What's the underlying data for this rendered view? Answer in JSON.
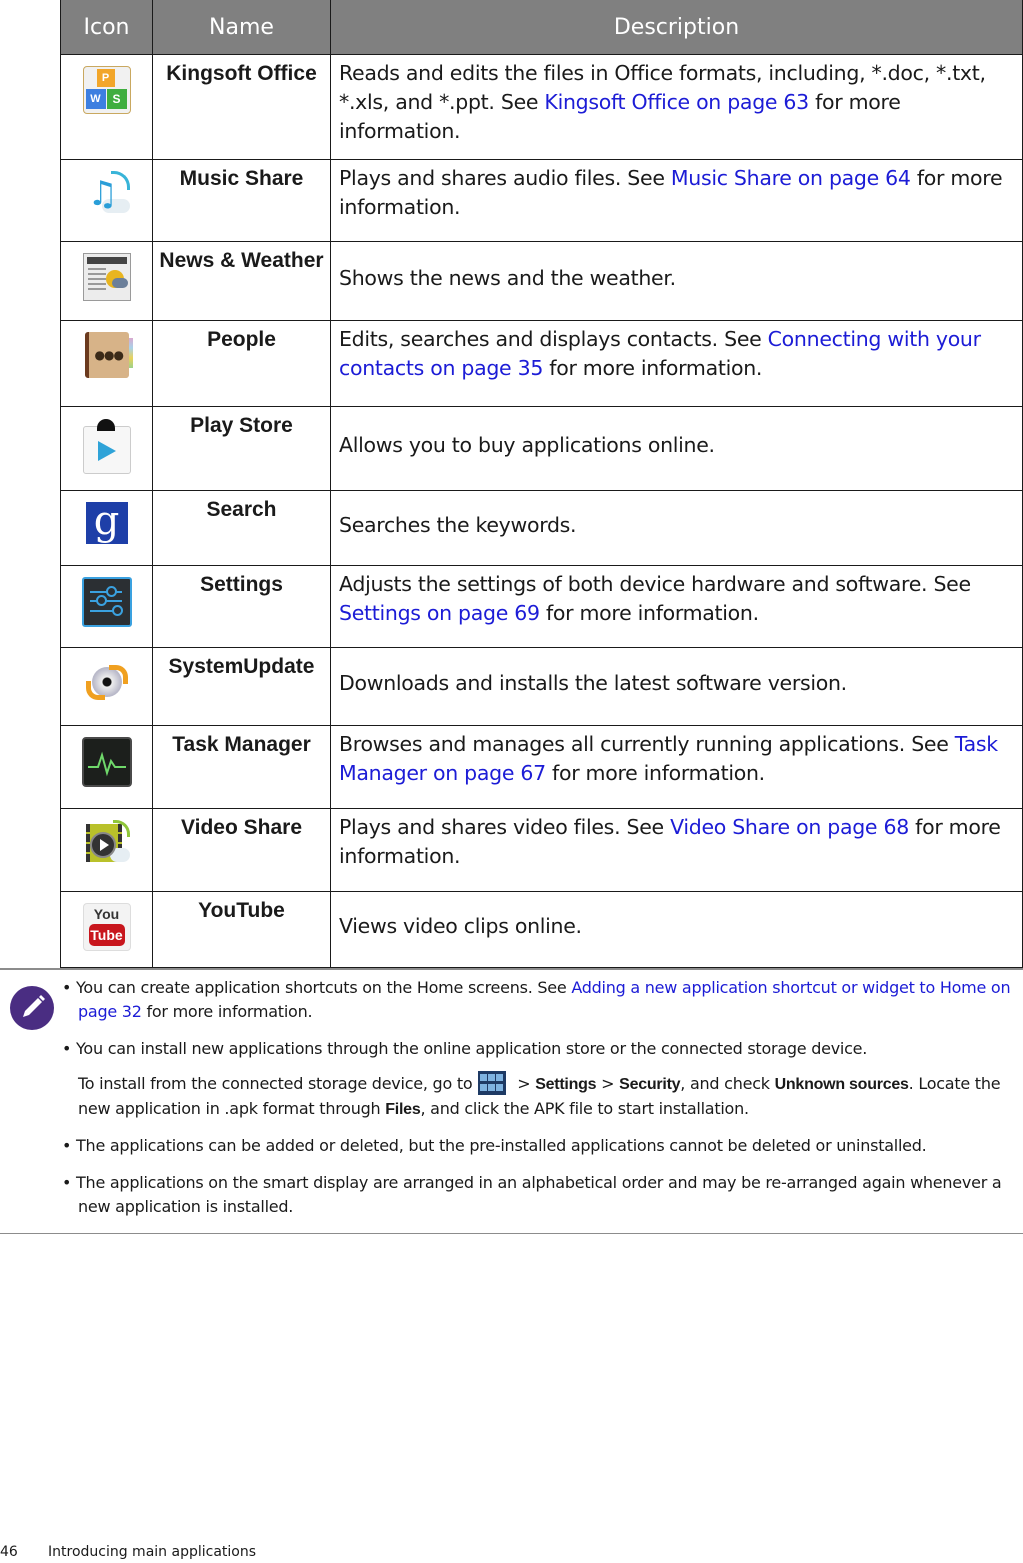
{
  "table": {
    "headers": [
      "Icon",
      "Name",
      "Description"
    ],
    "rows": [
      {
        "icon": "kingsoft-office-icon",
        "name": "Kingsoft Office",
        "desc_before": "Reads and edits the files in Office formats, including, *.doc, *.txt, *.xls, and *.ppt. See ",
        "link": "Kingsoft Office on page 63",
        "desc_after": " for more information."
      },
      {
        "icon": "music-share-icon",
        "name": "Music Share",
        "desc_before": "Plays and shares audio files. See ",
        "link": "Music Share on page 64",
        "desc_after": " for more information."
      },
      {
        "icon": "news-weather-icon",
        "name": "News & Weather",
        "desc_before": "Shows the news and the weather.",
        "link": "",
        "desc_after": ""
      },
      {
        "icon": "people-icon",
        "name": "People",
        "desc_before": "Edits, searches and displays contacts. See ",
        "link": "Connecting with your contacts on page 35",
        "desc_after": " for more information."
      },
      {
        "icon": "play-store-icon",
        "name": "Play Store",
        "desc_before": "Allows you to buy applications online.",
        "link": "",
        "desc_after": ""
      },
      {
        "icon": "search-icon",
        "name": "Search",
        "desc_before": "Searches the keywords.",
        "link": "",
        "desc_after": ""
      },
      {
        "icon": "settings-icon",
        "name": "Settings",
        "desc_before": "Adjusts the settings of both device hardware and software. See ",
        "link": "Settings on page 69",
        "desc_after": " for more information."
      },
      {
        "icon": "system-update-icon",
        "name": "SystemUpdate",
        "desc_before": "Downloads and installs the latest software version.",
        "link": "",
        "desc_after": ""
      },
      {
        "icon": "task-manager-icon",
        "name": "Task Manager",
        "desc_before": "Browses and manages all currently running applications. See ",
        "link": "Task Manager on page 67",
        "desc_after": " for more information."
      },
      {
        "icon": "video-share-icon",
        "name": "Video Share",
        "desc_before": "Plays and shares video files. See ",
        "link": "Video Share on page 68",
        "desc_after": " for more information."
      },
      {
        "icon": "youtube-icon",
        "name": "YouTube",
        "desc_before": "Views video clips online.",
        "link": "",
        "desc_after": ""
      }
    ]
  },
  "note": {
    "icon": "pencil-note-icon",
    "b1_before": "You can create application shortcuts on the Home screens. See ",
    "b1_link": "Adding a new application shortcut or widget to Home on page 32",
    "b1_after": " for more information.",
    "b2": "You can install new applications through the online application store or the connected storage device.",
    "b2_sub_1": "To install from the connected storage device, go to",
    "b2_sub_sep1": " > ",
    "b2_sub_settings": "Settings",
    "b2_sub_sep2": " > ",
    "b2_sub_security": "Security",
    "b2_sub_2": ", and check ",
    "b2_sub_unknown": "Unknown sources",
    "b2_sub_3": ". Locate the new application in .apk format through ",
    "b2_sub_files": "Files",
    "b2_sub_4": ", and click the APK file to start installation.",
    "b3": "The applications can be added or deleted, but the pre-installed applications cannot be deleted or uninstalled.",
    "b4": "The applications on the smart display are arranged in an alphabetical order and may be re-arranged again whenever a new application is installed.",
    "bullet_char": "•"
  },
  "footer": {
    "page_number": "46",
    "section": "Introducing main applications"
  },
  "colors": {
    "header_bg": "#808080",
    "link": "#1c1cd6",
    "note_icon": "#4a2d82"
  }
}
